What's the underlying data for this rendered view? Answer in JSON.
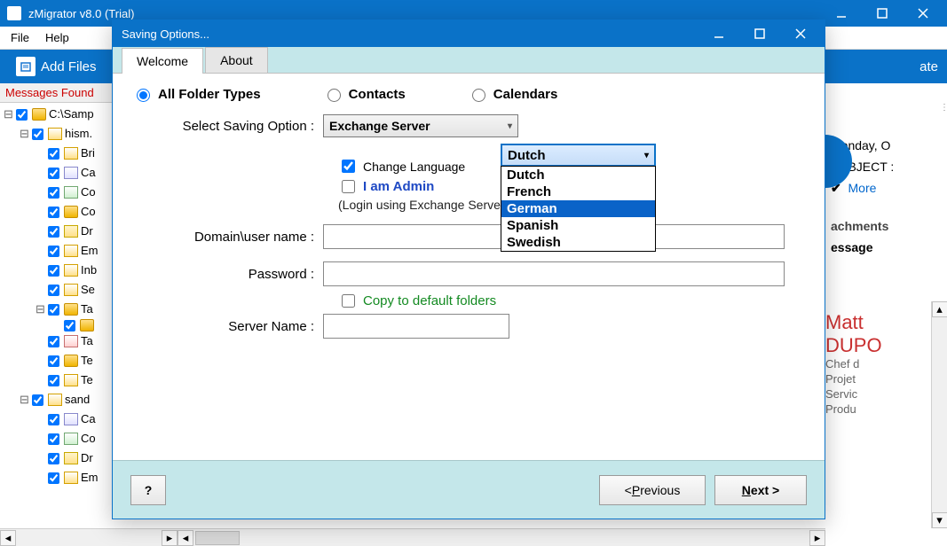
{
  "main_window": {
    "title": "zMigrator v8.0 (Trial)"
  },
  "menubar": {
    "file": "File",
    "help": "Help"
  },
  "toolbar": {
    "add_files": "Add Files",
    "right_btn": "ate"
  },
  "sidebar": {
    "messages_found": "Messages Found",
    "items": [
      {
        "depth": 0,
        "twist": "⊟",
        "icon": "folder",
        "label": "C:\\Samp"
      },
      {
        "depth": 1,
        "twist": "⊟",
        "icon": "mail",
        "label": "hism."
      },
      {
        "depth": 2,
        "twist": "",
        "icon": "mail",
        "label": "Bri"
      },
      {
        "depth": 2,
        "twist": "",
        "icon": "cal",
        "label": "Ca"
      },
      {
        "depth": 2,
        "twist": "",
        "icon": "contact",
        "label": "Co"
      },
      {
        "depth": 2,
        "twist": "",
        "icon": "folder",
        "label": "Co"
      },
      {
        "depth": 2,
        "twist": "",
        "icon": "note",
        "label": "Dr"
      },
      {
        "depth": 2,
        "twist": "",
        "icon": "mail",
        "label": "Em"
      },
      {
        "depth": 2,
        "twist": "",
        "icon": "mail",
        "label": "Inb"
      },
      {
        "depth": 2,
        "twist": "",
        "icon": "mail",
        "label": "Se"
      },
      {
        "depth": 2,
        "twist": "⊟",
        "icon": "folder",
        "label": "Ta"
      },
      {
        "depth": 3,
        "twist": "",
        "icon": "folder",
        "label": ""
      },
      {
        "depth": 2,
        "twist": "",
        "icon": "task",
        "label": "Ta"
      },
      {
        "depth": 2,
        "twist": "",
        "icon": "folder",
        "label": "Te"
      },
      {
        "depth": 2,
        "twist": "",
        "icon": "mail",
        "label": "Te"
      },
      {
        "depth": 1,
        "twist": "⊟",
        "icon": "mail",
        "label": "sand"
      },
      {
        "depth": 2,
        "twist": "",
        "icon": "cal",
        "label": "Ca"
      },
      {
        "depth": 2,
        "twist": "",
        "icon": "contact",
        "label": "Co"
      },
      {
        "depth": 2,
        "twist": "",
        "icon": "note",
        "label": "Dr"
      },
      {
        "depth": 2,
        "twist": "",
        "icon": "mail",
        "label": "Em"
      }
    ]
  },
  "rightpane": {
    "date": "Monday, O",
    "subject": "SUBJECT :",
    "more": "More",
    "attachments": "achments",
    "message": "essage",
    "name": "Matt",
    "name2": "DUPO",
    "sub1": "Chef d",
    "sub2": "Projet",
    "sub3": "Servic",
    "sub4": "Produ"
  },
  "dialog": {
    "title": "Saving Options...",
    "tabs": {
      "welcome": "Welcome",
      "about": "About"
    },
    "folder_types": {
      "all": "All Folder Types",
      "contacts": "Contacts",
      "calendars": "Calendars"
    },
    "select_saving_label": "Select Saving Option :",
    "saving_value": "Exchange Server",
    "change_language": "Change Language",
    "language_selected": "Dutch",
    "language_options": [
      "Dutch",
      "French",
      "German",
      "Spanish",
      "Swedish"
    ],
    "language_highlight": "German",
    "i_am_admin": "I am Admin",
    "login_hint": "(Login using Exchange Server                       up All User Accounts)",
    "domain_label": "Domain\\user name :",
    "password_label": "Password :",
    "copy_default": "Copy to default folders",
    "server_label": "Server Name :",
    "buttons": {
      "help": "?",
      "prev_lt": "<  ",
      "prev_u": "P",
      "prev_rest": "revious",
      "next_u": "N",
      "next_rest": "ext >"
    }
  }
}
